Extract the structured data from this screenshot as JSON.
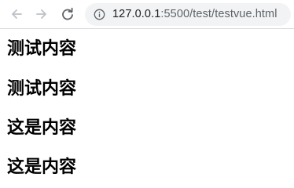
{
  "browser": {
    "url_host": "127.0.0.1",
    "url_rest": ":5500/test/testvue.html",
    "icons": {
      "back": "arrow-left-icon",
      "forward": "arrow-right-icon",
      "reload": "reload-icon",
      "info": "info-icon"
    },
    "colors": {
      "icon": "#5f6368",
      "icon_disabled": "#bdc1c6",
      "omnibox_bg": "#f1f3f4"
    }
  },
  "page": {
    "headings": [
      "测试内容",
      "测试内容",
      "这是内容",
      "这是内容"
    ]
  }
}
